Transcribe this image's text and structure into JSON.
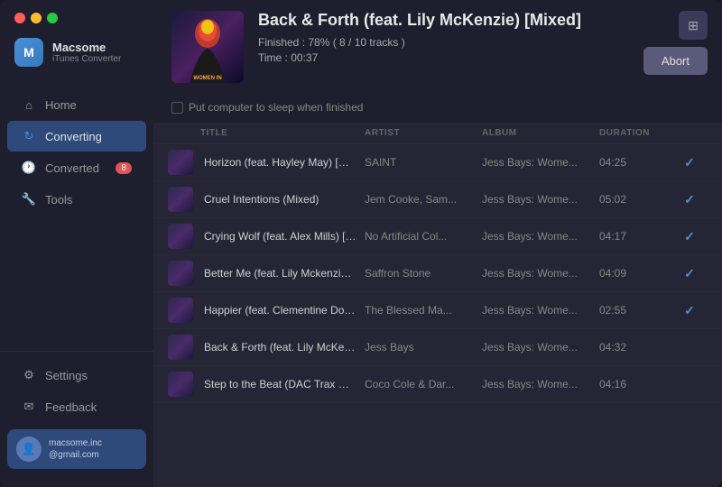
{
  "window": {
    "title": "Macsome iTunes Converter"
  },
  "sidebar": {
    "brand_name": "Macsome",
    "brand_sub": "iTunes Converter",
    "nav_items": [
      {
        "id": "home",
        "label": "Home",
        "icon": "🏠",
        "active": false
      },
      {
        "id": "converting",
        "label": "Converting",
        "icon": "⟳",
        "active": true
      },
      {
        "id": "converted",
        "label": "Converted",
        "icon": "🕐",
        "active": false,
        "badge": "8"
      },
      {
        "id": "tools",
        "label": "Tools",
        "icon": "🔧",
        "active": false
      }
    ],
    "bottom_items": [
      {
        "id": "settings",
        "label": "Settings",
        "icon": "⚙"
      },
      {
        "id": "feedback",
        "label": "Feedback",
        "icon": "✉"
      }
    ],
    "user": {
      "email_line1": "macsome.inc",
      "email_line2": "@gmail.com"
    }
  },
  "header": {
    "album_title": "Back & Forth (feat. Lily McKenzie) [Mixed]",
    "progress_text": "Finished : 78% ( 8 / 10 tracks )",
    "time_text": "Time :  00:37",
    "sleep_label": "Put computer to sleep when finished",
    "abort_label": "Abort"
  },
  "table": {
    "columns": [
      "",
      "TITLE",
      "ARTIST",
      "ALBUM",
      "DURATION",
      ""
    ],
    "rows": [
      {
        "title": "Horizon (feat. Hayley May) [Mixed]",
        "artist": "SAINT",
        "album": "Jess Bays: Wome...",
        "duration": "04:25",
        "done": true
      },
      {
        "title": "Cruel Intentions (Mixed)",
        "artist": "Jem Cooke, Sam...",
        "album": "Jess Bays: Wome...",
        "duration": "05:02",
        "done": true
      },
      {
        "title": "Crying Wolf (feat. Alex Mills) [Mixed]",
        "artist": "No Artificial Col...",
        "album": "Jess Bays: Wome...",
        "duration": "04:17",
        "done": true
      },
      {
        "title": "Better Me (feat. Lily Mckenzie) [Mixed]",
        "artist": "Saffron Stone",
        "album": "Jess Bays: Wome...",
        "duration": "04:09",
        "done": true
      },
      {
        "title": "Happier (feat. Clementine Douglas) [..  ",
        "artist": "The Blessed Ma...",
        "album": "Jess Bays: Wome...",
        "duration": "02:55",
        "done": true
      },
      {
        "title": "Back & Forth (feat. Lily McKenzie) [Mi...",
        "artist": "Jess Bays",
        "album": "Jess Bays: Wome...",
        "duration": "04:32",
        "done": false
      },
      {
        "title": "Step to the Beat (DAC Trax Mix) [Mixed]",
        "artist": "Coco Cole & Dar...",
        "album": "Jess Bays: Wome...",
        "duration": "04:16",
        "done": false
      }
    ]
  }
}
